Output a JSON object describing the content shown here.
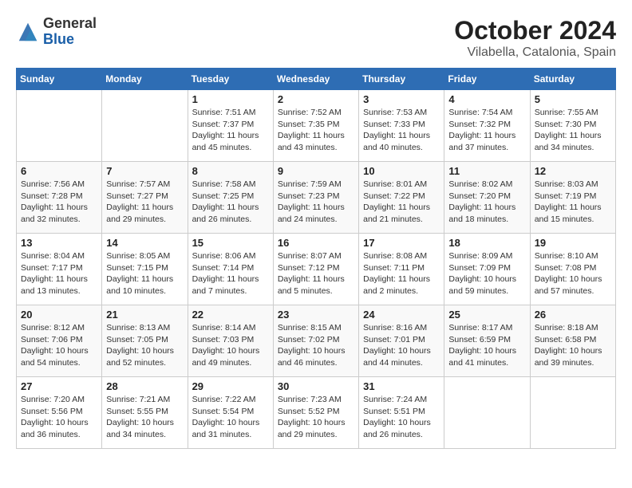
{
  "header": {
    "logo_general": "General",
    "logo_blue": "Blue",
    "title": "October 2024",
    "subtitle": "Vilabella, Catalonia, Spain"
  },
  "days_of_week": [
    "Sunday",
    "Monday",
    "Tuesday",
    "Wednesday",
    "Thursday",
    "Friday",
    "Saturday"
  ],
  "weeks": [
    [
      {
        "day": "",
        "detail": ""
      },
      {
        "day": "",
        "detail": ""
      },
      {
        "day": "1",
        "detail": "Sunrise: 7:51 AM\nSunset: 7:37 PM\nDaylight: 11 hours and 45 minutes."
      },
      {
        "day": "2",
        "detail": "Sunrise: 7:52 AM\nSunset: 7:35 PM\nDaylight: 11 hours and 43 minutes."
      },
      {
        "day": "3",
        "detail": "Sunrise: 7:53 AM\nSunset: 7:33 PM\nDaylight: 11 hours and 40 minutes."
      },
      {
        "day": "4",
        "detail": "Sunrise: 7:54 AM\nSunset: 7:32 PM\nDaylight: 11 hours and 37 minutes."
      },
      {
        "day": "5",
        "detail": "Sunrise: 7:55 AM\nSunset: 7:30 PM\nDaylight: 11 hours and 34 minutes."
      }
    ],
    [
      {
        "day": "6",
        "detail": "Sunrise: 7:56 AM\nSunset: 7:28 PM\nDaylight: 11 hours and 32 minutes."
      },
      {
        "day": "7",
        "detail": "Sunrise: 7:57 AM\nSunset: 7:27 PM\nDaylight: 11 hours and 29 minutes."
      },
      {
        "day": "8",
        "detail": "Sunrise: 7:58 AM\nSunset: 7:25 PM\nDaylight: 11 hours and 26 minutes."
      },
      {
        "day": "9",
        "detail": "Sunrise: 7:59 AM\nSunset: 7:23 PM\nDaylight: 11 hours and 24 minutes."
      },
      {
        "day": "10",
        "detail": "Sunrise: 8:01 AM\nSunset: 7:22 PM\nDaylight: 11 hours and 21 minutes."
      },
      {
        "day": "11",
        "detail": "Sunrise: 8:02 AM\nSunset: 7:20 PM\nDaylight: 11 hours and 18 minutes."
      },
      {
        "day": "12",
        "detail": "Sunrise: 8:03 AM\nSunset: 7:19 PM\nDaylight: 11 hours and 15 minutes."
      }
    ],
    [
      {
        "day": "13",
        "detail": "Sunrise: 8:04 AM\nSunset: 7:17 PM\nDaylight: 11 hours and 13 minutes."
      },
      {
        "day": "14",
        "detail": "Sunrise: 8:05 AM\nSunset: 7:15 PM\nDaylight: 11 hours and 10 minutes."
      },
      {
        "day": "15",
        "detail": "Sunrise: 8:06 AM\nSunset: 7:14 PM\nDaylight: 11 hours and 7 minutes."
      },
      {
        "day": "16",
        "detail": "Sunrise: 8:07 AM\nSunset: 7:12 PM\nDaylight: 11 hours and 5 minutes."
      },
      {
        "day": "17",
        "detail": "Sunrise: 8:08 AM\nSunset: 7:11 PM\nDaylight: 11 hours and 2 minutes."
      },
      {
        "day": "18",
        "detail": "Sunrise: 8:09 AM\nSunset: 7:09 PM\nDaylight: 10 hours and 59 minutes."
      },
      {
        "day": "19",
        "detail": "Sunrise: 8:10 AM\nSunset: 7:08 PM\nDaylight: 10 hours and 57 minutes."
      }
    ],
    [
      {
        "day": "20",
        "detail": "Sunrise: 8:12 AM\nSunset: 7:06 PM\nDaylight: 10 hours and 54 minutes."
      },
      {
        "day": "21",
        "detail": "Sunrise: 8:13 AM\nSunset: 7:05 PM\nDaylight: 10 hours and 52 minutes."
      },
      {
        "day": "22",
        "detail": "Sunrise: 8:14 AM\nSunset: 7:03 PM\nDaylight: 10 hours and 49 minutes."
      },
      {
        "day": "23",
        "detail": "Sunrise: 8:15 AM\nSunset: 7:02 PM\nDaylight: 10 hours and 46 minutes."
      },
      {
        "day": "24",
        "detail": "Sunrise: 8:16 AM\nSunset: 7:01 PM\nDaylight: 10 hours and 44 minutes."
      },
      {
        "day": "25",
        "detail": "Sunrise: 8:17 AM\nSunset: 6:59 PM\nDaylight: 10 hours and 41 minutes."
      },
      {
        "day": "26",
        "detail": "Sunrise: 8:18 AM\nSunset: 6:58 PM\nDaylight: 10 hours and 39 minutes."
      }
    ],
    [
      {
        "day": "27",
        "detail": "Sunrise: 7:20 AM\nSunset: 5:56 PM\nDaylight: 10 hours and 36 minutes."
      },
      {
        "day": "28",
        "detail": "Sunrise: 7:21 AM\nSunset: 5:55 PM\nDaylight: 10 hours and 34 minutes."
      },
      {
        "day": "29",
        "detail": "Sunrise: 7:22 AM\nSunset: 5:54 PM\nDaylight: 10 hours and 31 minutes."
      },
      {
        "day": "30",
        "detail": "Sunrise: 7:23 AM\nSunset: 5:52 PM\nDaylight: 10 hours and 29 minutes."
      },
      {
        "day": "31",
        "detail": "Sunrise: 7:24 AM\nSunset: 5:51 PM\nDaylight: 10 hours and 26 minutes."
      },
      {
        "day": "",
        "detail": ""
      },
      {
        "day": "",
        "detail": ""
      }
    ]
  ]
}
